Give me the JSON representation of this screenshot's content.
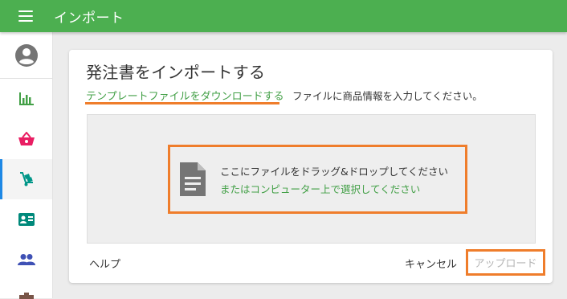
{
  "app": {
    "title": "インポート"
  },
  "sidebar": {
    "items": [
      {
        "icon": "bar-chart-icon",
        "color": "#43a047"
      },
      {
        "icon": "basket-icon",
        "color": "#e91e63"
      },
      {
        "icon": "hand-truck-icon",
        "color": "#009688",
        "active": true
      },
      {
        "icon": "id-card-icon",
        "color": "#00897b"
      },
      {
        "icon": "people-icon",
        "color": "#3f51b5"
      }
    ]
  },
  "dialog": {
    "title": "発注書をインポートする",
    "template_link": "テンプレートファイルをダウンロードする",
    "instruction": "ファイルに商品情報を入力してください。",
    "dropzone": {
      "main_text": "ここにファイルをドラッグ&ドロップしてください",
      "sub_text": "またはコンピューター上で選択してください"
    },
    "help_label": "ヘルプ",
    "cancel_label": "キャンセル",
    "upload_label": "アップロード"
  },
  "colors": {
    "topbar": "#4caf50",
    "accent_green": "#43a047",
    "highlight_orange": "#ef7d2b",
    "active_indicator": "#1e88e5"
  }
}
